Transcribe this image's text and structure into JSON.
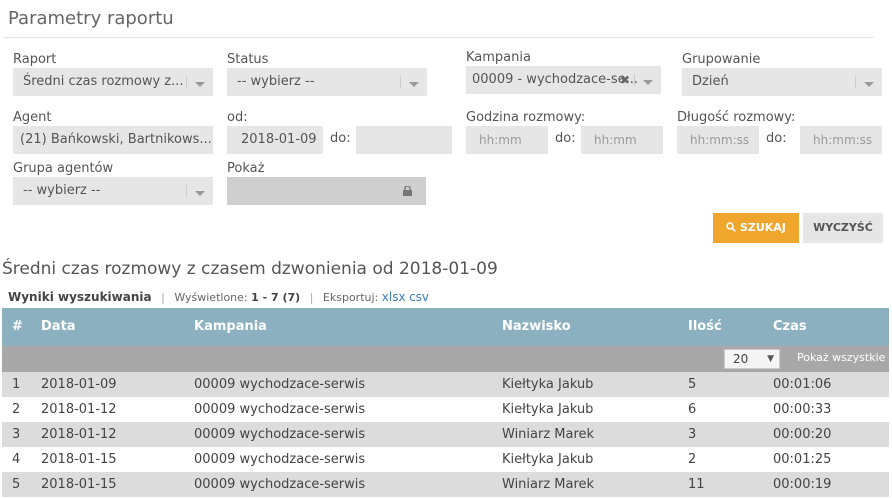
{
  "page_title": "Parametry raportu",
  "form": {
    "raport": {
      "label": "Raport",
      "value": "Średni czas rozmowy z..."
    },
    "status": {
      "label": "Status",
      "value": "-- wybierz --"
    },
    "kampania": {
      "label": "Kampania",
      "value": "00009 - wychodzace-se..."
    },
    "grupowanie": {
      "label": "Grupowanie",
      "value": "Dzień"
    },
    "agent": {
      "label": "Agent",
      "value": "(21) Bańkowski, Bartnikows..."
    },
    "od": {
      "label": "od:",
      "value": "2018-01-09"
    },
    "do_date": {
      "label": "do:",
      "value": ""
    },
    "godzina": {
      "label": "Godzina rozmowy:",
      "from_placeholder": "hh:mm",
      "to_label": "do:",
      "to_placeholder": "hh:mm"
    },
    "dlugosc": {
      "label": "Długość rozmowy:",
      "from_placeholder": "hh:mm:ss",
      "to_label": "do:",
      "to_placeholder": "hh:mm:ss"
    },
    "grupa": {
      "label": "Grupa agentów",
      "value": "-- wybierz --"
    },
    "pokaz": {
      "label": "Pokaż",
      "value": ""
    }
  },
  "buttons": {
    "search": "SZUKAJ",
    "clear": "WYCZYŚĆ"
  },
  "results": {
    "title": "Średni czas rozmowy z czasem dzwonienia od 2018-01-09",
    "tab_label": "Wyniki wyszukiwania",
    "shown_label": "Wyświetlone:",
    "shown_value": "1 - 7 (7)",
    "export_label": "Eksportuj:",
    "export_xlsx": "xlsx",
    "export_csv": "csv",
    "page_size": "20",
    "show_all": "Pokaż wszystkie",
    "columns": [
      "#",
      "Data",
      "Kampania",
      "Nazwisko",
      "Ilość",
      "Czas"
    ],
    "rows": [
      {
        "n": "1",
        "data": "2018-01-09",
        "kampania": "00009 wychodzace-serwis",
        "nazwisko": "Kiełtyka Jakub",
        "ilosc": "5",
        "czas": "00:01:06"
      },
      {
        "n": "2",
        "data": "2018-01-12",
        "kampania": "00009 wychodzace-serwis",
        "nazwisko": "Kiełtyka Jakub",
        "ilosc": "6",
        "czas": "00:00:33"
      },
      {
        "n": "3",
        "data": "2018-01-12",
        "kampania": "00009 wychodzace-serwis",
        "nazwisko": "Winiarz Marek",
        "ilosc": "3",
        "czas": "00:00:20"
      },
      {
        "n": "4",
        "data": "2018-01-15",
        "kampania": "00009 wychodzace-serwis",
        "nazwisko": "Kiełtyka Jakub",
        "ilosc": "2",
        "czas": "00:01:25"
      },
      {
        "n": "5",
        "data": "2018-01-15",
        "kampania": "00009 wychodzace-serwis",
        "nazwisko": "Winiarz Marek",
        "ilosc": "11",
        "czas": "00:00:19"
      }
    ]
  }
}
